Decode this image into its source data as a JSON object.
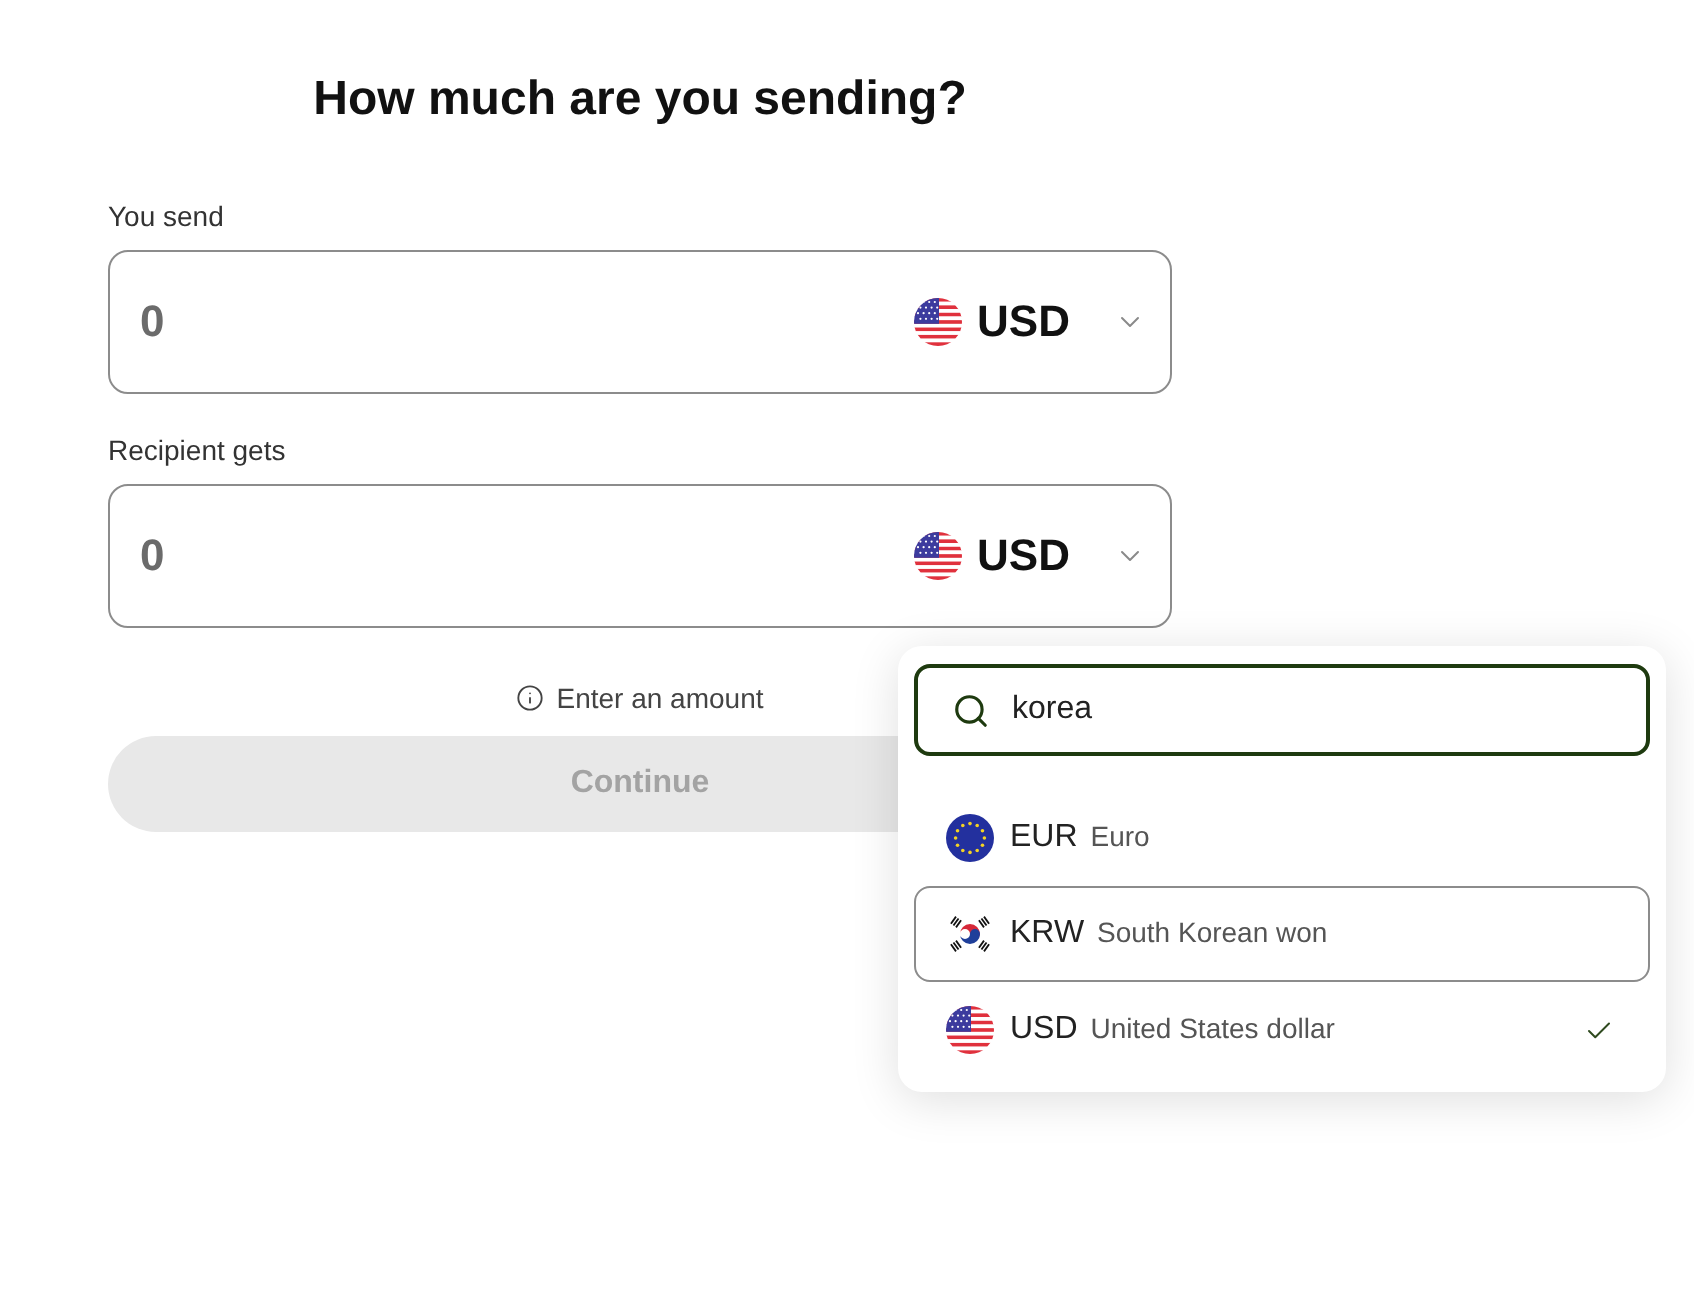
{
  "title": "How much are you sending?",
  "fields": [
    {
      "label": "You send",
      "placeholder": "0",
      "currency": {
        "code": "USD",
        "kind": "us"
      }
    },
    {
      "label": "Recipient gets",
      "placeholder": "0",
      "currency": {
        "code": "USD",
        "kind": "us"
      }
    }
  ],
  "hint": "Enter an amount",
  "continue_button": {
    "label": "Continue",
    "disabled": true
  },
  "dropdown": {
    "open": true,
    "search": {
      "value": "korea"
    },
    "options": [
      {
        "code": "EUR",
        "name": "Euro",
        "kind": "eu",
        "highlighted": false,
        "selected": false
      },
      {
        "code": "KRW",
        "name": "South Korean won",
        "kind": "kr",
        "highlighted": true,
        "selected": false
      },
      {
        "code": "USD",
        "name": "United States dollar",
        "kind": "us",
        "highlighted": false,
        "selected": true
      }
    ]
  }
}
